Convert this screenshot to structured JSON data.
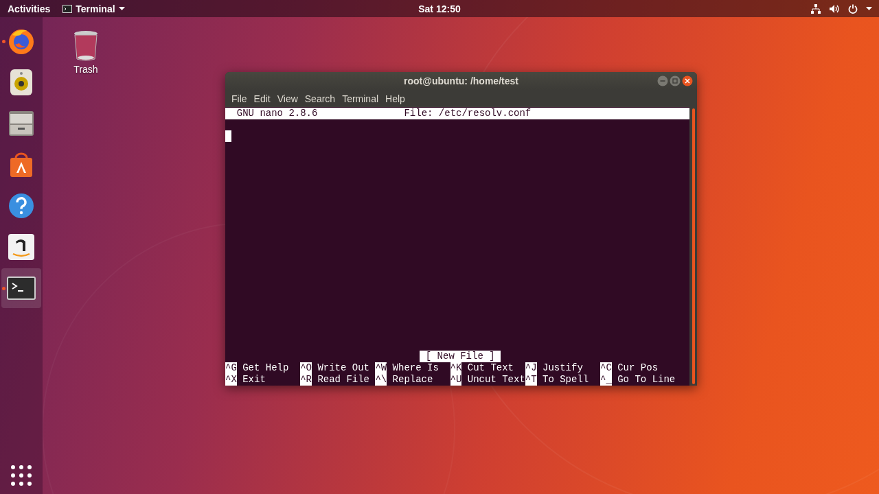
{
  "top_bar": {
    "activities": "Activities",
    "app_menu": "Terminal",
    "clock": "Sat 12:50"
  },
  "dock": {
    "items": [
      {
        "kind": "firefox",
        "running": true,
        "selected": false
      },
      {
        "kind": "speaker",
        "running": false,
        "selected": false
      },
      {
        "kind": "files",
        "running": false,
        "selected": false
      },
      {
        "kind": "software",
        "running": false,
        "selected": false
      },
      {
        "kind": "help",
        "running": false,
        "selected": false
      },
      {
        "kind": "amazon",
        "running": false,
        "selected": false
      },
      {
        "kind": "terminal",
        "running": true,
        "selected": true
      }
    ]
  },
  "desktop_icons": [
    {
      "label": "Trash"
    }
  ],
  "window": {
    "title": "root@ubuntu: /home/test",
    "menu": [
      "File",
      "Edit",
      "View",
      "Search",
      "Terminal",
      "Help"
    ],
    "nano": {
      "version": "GNU nano 2.8.6",
      "file": "File: /etc/resolv.conf",
      "status": "[ New File ]",
      "shortcuts": [
        [
          {
            "key": "^G",
            "label": "Get Help"
          },
          {
            "key": "^O",
            "label": "Write Out"
          },
          {
            "key": "^W",
            "label": "Where Is"
          },
          {
            "key": "^K",
            "label": "Cut Text"
          },
          {
            "key": "^J",
            "label": "Justify"
          },
          {
            "key": "^C",
            "label": "Cur Pos"
          }
        ],
        [
          {
            "key": "^X",
            "label": "Exit"
          },
          {
            "key": "^R",
            "label": "Read File"
          },
          {
            "key": "^\\",
            "label": "Replace"
          },
          {
            "key": "^U",
            "label": "Uncut Text"
          },
          {
            "key": "^T",
            "label": "To Spell"
          },
          {
            "key": "^_",
            "label": "Go To Line"
          }
        ]
      ]
    }
  }
}
